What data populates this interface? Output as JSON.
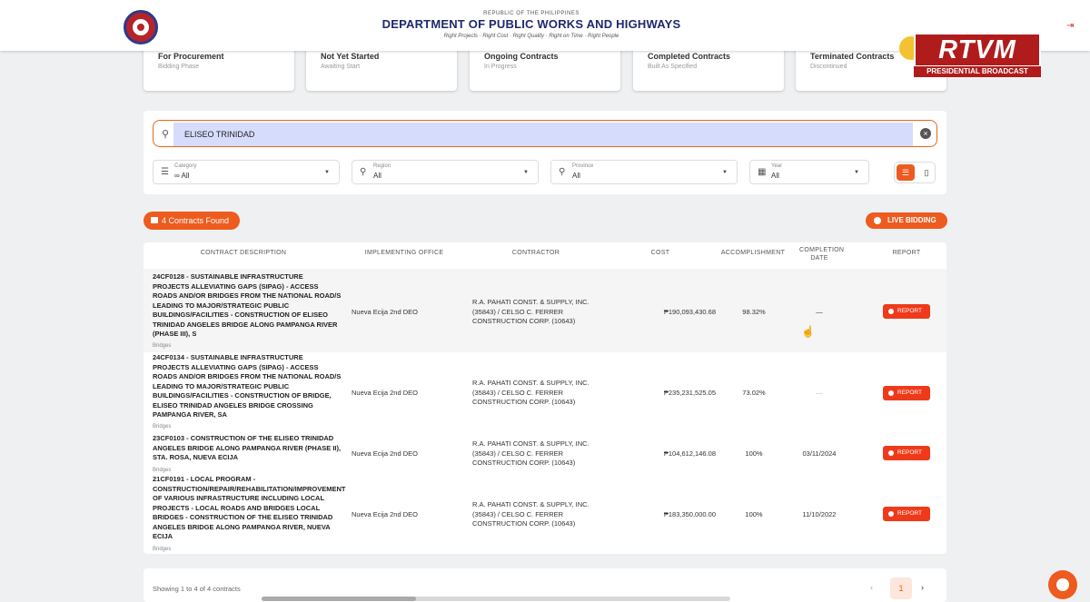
{
  "header": {
    "small_title": "REPUBLIC OF THE PHILIPPINES",
    "title": "DEPARTMENT OF PUBLIC WORKS AND HIGHWAYS",
    "tagline": "Right Projects · Right Cost · Right Quality · Right on Time · Right People"
  },
  "cards": [
    {
      "title": "For Procurement",
      "sub": "Bidding Phase"
    },
    {
      "title": "Not Yet Started",
      "sub": "Awaiting Start"
    },
    {
      "title": "Ongoing Contracts",
      "sub": "In Progress"
    },
    {
      "title": "Completed Contracts",
      "sub": "Built As Specified"
    },
    {
      "title": "Terminated Contracts",
      "sub": "Discontinued"
    }
  ],
  "overlay": {
    "logo_text": "RTVM",
    "sub": "PRESIDENTIAL BROADCAST"
  },
  "search": {
    "value": "ELISEO TRINIDAD"
  },
  "filters": [
    {
      "label": "Category",
      "value": "All"
    },
    {
      "label": "Region",
      "value": "All"
    },
    {
      "label": "Province",
      "value": "All"
    },
    {
      "label": "Year",
      "value": "All"
    }
  ],
  "results": {
    "count_label": "4 Contracts Found",
    "live_label": "LIVE BIDDING"
  },
  "table": {
    "headers": [
      "CONTRACT DESCRIPTION",
      "IMPLEMENTING OFFICE",
      "CONTRACTOR",
      "COST",
      "ACCOMPLISHMENT",
      "COMPLETION DATE",
      "REPORT"
    ],
    "rows": [
      {
        "description": "24CF0128 - SUSTAINABLE INFRASTRUCTURE PROJECTS ALLEVIATING GAPS (SIPAG) - ACCESS ROADS AND/OR BRIDGES FROM THE NATIONAL ROAD/S LEADING TO MAJOR/STRATEGIC PUBLIC BUILDINGS/FACILITIES - CONSTRUCTION OF ELISEO TRINIDAD ANGELES BRIDGE ALONG PAMPANGA RIVER (PHASE III), S",
        "category": "Bridges",
        "office": "Nueva Ecija 2nd DEO",
        "contractor": "R.A. PAHATI CONST. & SUPPLY, INC. (35843) / CELSO C. FERRER CONSTRUCTION CORP. (10643)",
        "cost": "₱190,093,430.68",
        "accomplishment": "98.32%",
        "completion": "—",
        "report": "REPORT"
      },
      {
        "description": "24CF0134 - SUSTAINABLE INFRASTRUCTURE PROJECTS ALLEVIATING GAPS (SIPAG) - ACCESS ROADS AND/OR BRIDGES FROM THE NATIONAL ROAD/S LEADING TO MAJOR/STRATEGIC PUBLIC BUILDINGS/FACILITIES - CONSTRUCTION OF BRIDGE, ELISEO TRINIDAD ANGELES BRIDGE CROSSING PAMPANGA RIVER, SA",
        "category": "Bridges",
        "office": "Nueva Ecija 2nd DEO",
        "contractor": "R.A. PAHATI CONST. & SUPPLY, INC. (35843) / CELSO C. FERRER CONSTRUCTION CORP. (10643)",
        "cost": "₱235,231,525.05",
        "accomplishment": "73.02%",
        "completion": "—",
        "report": "REPORT"
      },
      {
        "description": "23CF0103 - CONSTRUCTION OF THE ELISEO TRINIDAD ANGELES BRIDGE ALONG PAMPANGA RIVER (PHASE II), STA. ROSA, NUEVA ECIJA",
        "category": "Bridges",
        "office": "Nueva Ecija 2nd DEO",
        "contractor": "R.A. PAHATI CONST. & SUPPLY, INC. (35843) / CELSO C. FERRER CONSTRUCTION CORP. (10643)",
        "cost": "₱104,612,146.08",
        "accomplishment": "100%",
        "completion": "03/11/2024",
        "report": "REPORT"
      },
      {
        "description": "21CF0191 - LOCAL PROGRAM - CONSTRUCTION/REPAIR/REHABILITATION/IMPROVEMENT OF VARIOUS INFRASTRUCTURE INCLUDING LOCAL PROJECTS - LOCAL ROADS AND BRIDGES LOCAL BRIDGES - CONSTRUCTION OF THE ELISEO TRINIDAD ANGELES BRIDGE ALONG PAMPANGA RIVER, NUEVA ECIJA",
        "category": "Bridges",
        "office": "Nueva Ecija 2nd DEO",
        "contractor": "R.A. PAHATI CONST. & SUPPLY, INC. (35843) / CELSO C. FERRER CONSTRUCTION CORP. (10643)",
        "cost": "₱183,350,000.00",
        "accomplishment": "100%",
        "completion": "11/10/2022",
        "report": "REPORT"
      }
    ]
  },
  "footer": {
    "showing": "Showing 1 to 4 of 4 contracts",
    "page": "1"
  }
}
